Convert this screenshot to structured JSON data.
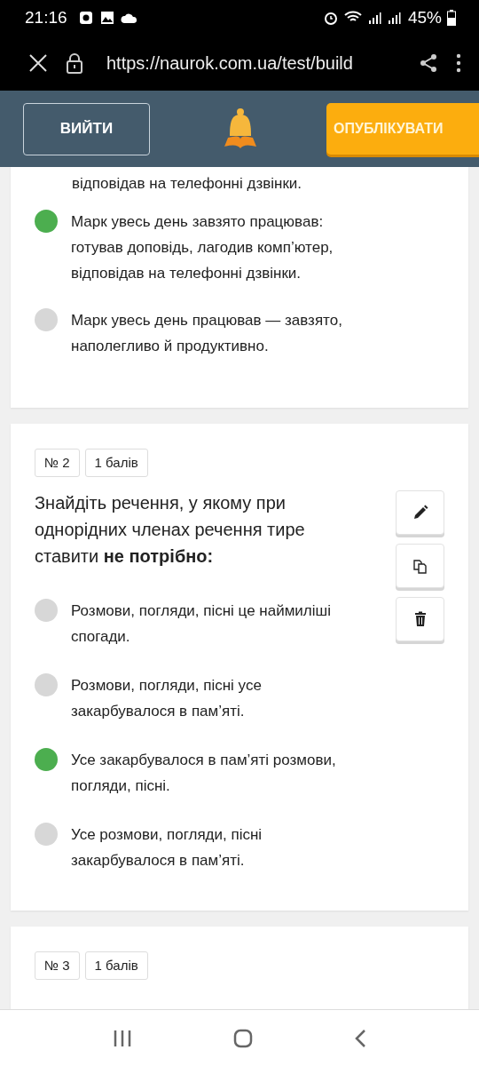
{
  "status_bar": {
    "time": "21:16",
    "battery": "45%"
  },
  "browser": {
    "url": "https://naurok.com.ua/test/build"
  },
  "header": {
    "exit_button": "ВИЙТИ",
    "publish_button": "ОПУБЛІКУВАТИ"
  },
  "questions": [
    {
      "clipped_line": "відповідав на телефонні дзвінки.",
      "options": [
        {
          "text": "Марк увесь день завзято працював: готував доповідь, лагодив комп’ютер, відповідав на телефонні дзвінки.",
          "selected": true
        },
        {
          "text": "Марк увесь день працював — завзято, наполегливо й продуктивно.",
          "selected": false
        }
      ]
    },
    {
      "number": "№ 2",
      "points": "1 балів",
      "text": "Знайдіть речення, у якому при однорідних членах речення тире ставити **не потрібно:**",
      "actions": [
        {
          "kind": "edit"
        },
        {
          "kind": "copy"
        },
        {
          "kind": "delete"
        }
      ],
      "options": [
        {
          "text": "Розмови, погляди, пісні це наймиліші спогади.",
          "selected": false
        },
        {
          "text": "Розмови, погляди, пісні усе закарбувалося в пам’яті.",
          "selected": false
        },
        {
          "text": "Усе закарбувалося в пам’яті розмови, погляди, пісні.",
          "selected": true
        },
        {
          "text": "Усе розмови, погляди, пісні закарбувалося в пам’яті.",
          "selected": false
        }
      ]
    },
    {
      "number": "№ 3",
      "points": "1 балів"
    }
  ]
}
